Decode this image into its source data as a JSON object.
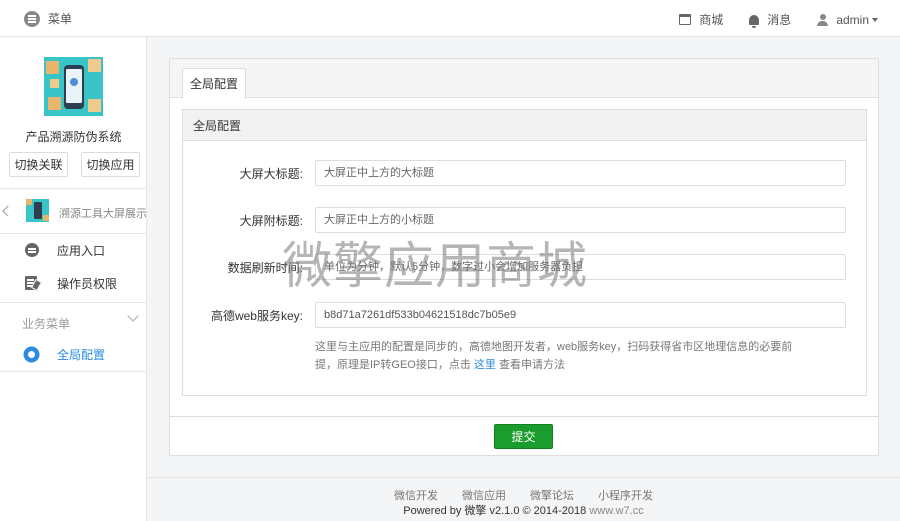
{
  "topbar": {
    "menu_label": "菜单",
    "shop_label": "商城",
    "messages_label": "消息",
    "user_label": "admin"
  },
  "sidebar": {
    "app_name": "产品溯源防伪系统",
    "switch_link_label": "切换关联",
    "switch_app_label": "切换应用",
    "module_name": "溯源工具大屏展示",
    "items": [
      {
        "label": "应用入口"
      },
      {
        "label": "操作员权限"
      }
    ],
    "group_title": "业务菜单",
    "group_items": [
      {
        "label": "全局配置",
        "active": true
      }
    ]
  },
  "main": {
    "tab_label": "全局配置",
    "section_title": "全局配置",
    "fields": [
      {
        "label": "大屏大标题:",
        "value": "",
        "placeholder": "大屏正中上方的大标题"
      },
      {
        "label": "大屏附标题:",
        "value": "",
        "placeholder": "大屏正中上方的小标题"
      },
      {
        "label": "数据刷新时间:",
        "value": "",
        "placeholder": "单位为分钟，默认5分钟，数字过小会增加服务器负担"
      },
      {
        "label": "高德web服务key:",
        "value": "b8d71a7261df533b04621518dc7b05e9",
        "placeholder": ""
      }
    ],
    "help_text_1": "这里与主应用的配置是同步的，高德地图开发者，web服务key，扫码获得省市区地理信息的必要前提，原理是IP转GEO接口，点击",
    "help_link": "这里",
    "help_text_2": "查看申请方法",
    "submit_label": "提交"
  },
  "watermark": "微擎应用商城",
  "footer": {
    "links": [
      "微信开发",
      "微信应用",
      "微擎论坛",
      "小程序开发"
    ],
    "copyright_prefix": "Powered by 微擎 v2.1.0 © 2014-2018",
    "copyright_site": "www.w7.cc"
  },
  "colors": {
    "accent": "#2a8be0",
    "submit": "#1a9d2c"
  }
}
